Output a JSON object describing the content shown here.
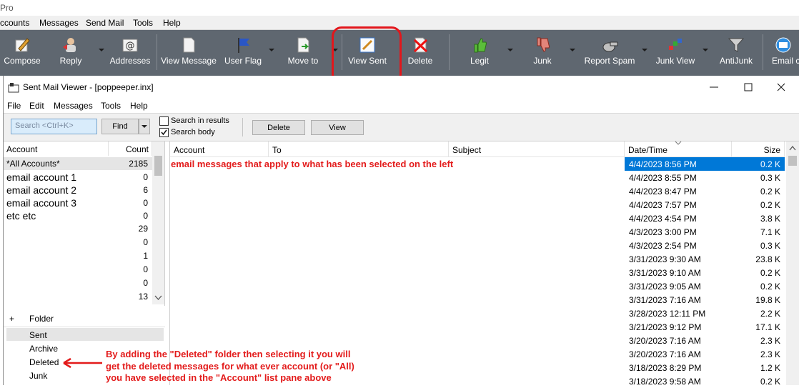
{
  "app": {
    "title_fragment": "Pro",
    "menu": [
      "ccounts",
      "Messages",
      "Send Mail",
      "Tools",
      "Help"
    ]
  },
  "toolbar": {
    "buttons": [
      {
        "label": "Compose",
        "icon": "compose-icon"
      },
      {
        "label": "Reply",
        "icon": "reply-icon"
      },
      {
        "label": "Addresses",
        "icon": "addresses-icon"
      },
      {
        "label": "View Message",
        "icon": "view-message-icon"
      },
      {
        "label": "User Flag",
        "icon": "flag-icon"
      },
      {
        "label": "Move to",
        "icon": "move-to-icon"
      },
      {
        "label": "View Sent",
        "icon": "view-sent-icon"
      },
      {
        "label": "Delete",
        "icon": "delete-icon"
      },
      {
        "label": "Legit",
        "icon": "thumbs-up-icon"
      },
      {
        "label": "Junk",
        "icon": "thumbs-down-icon"
      },
      {
        "label": "Report Spam",
        "icon": "whistle-icon"
      },
      {
        "label": "Junk View",
        "icon": "junk-view-icon"
      },
      {
        "label": "AntiJunk",
        "icon": "filter-icon"
      },
      {
        "label": "Email c",
        "icon": "email-check-icon"
      }
    ]
  },
  "window": {
    "title": "Sent Mail Viewer - [poppeeper.inx]",
    "menu": [
      "File",
      "Edit",
      "Messages",
      "Tools",
      "Help"
    ],
    "search_placeholder": "Search <Ctrl+K>",
    "find_label": "Find",
    "search_in_results": "Search in results",
    "search_body": "Search body",
    "search_in_results_checked": false,
    "search_body_checked": true,
    "delete_label": "Delete",
    "view_label": "View"
  },
  "accounts": {
    "col_account": "Account",
    "col_count": "Count",
    "rows": [
      {
        "name": "*All Accounts*",
        "count": "2185"
      },
      {
        "name": "email account 1",
        "count": "0"
      },
      {
        "name": "email account 2",
        "count": "6"
      },
      {
        "name": "email account 3",
        "count": "0"
      },
      {
        "name": "etc etc",
        "count": "0"
      },
      {
        "name": "",
        "count": "29"
      },
      {
        "name": "",
        "count": "0"
      },
      {
        "name": "",
        "count": "1"
      },
      {
        "name": "",
        "count": "0"
      },
      {
        "name": "",
        "count": "0"
      },
      {
        "name": "",
        "count": "13"
      }
    ]
  },
  "folders": {
    "expander": "+",
    "col_folder": "Folder",
    "items": [
      "Sent",
      "Archive",
      "Deleted",
      "Junk"
    ]
  },
  "messages": {
    "col_account": "Account",
    "col_to": "To",
    "col_subject": "Subject",
    "col_datetime": "Date/Time",
    "col_size": "Size",
    "rows": [
      {
        "date": "4/4/2023 8:56 PM",
        "size": "0.2 K"
      },
      {
        "date": "4/4/2023 8:55 PM",
        "size": "0.3 K"
      },
      {
        "date": "4/4/2023 8:47 PM",
        "size": "0.2 K"
      },
      {
        "date": "4/4/2023 7:57 PM",
        "size": "0.2 K"
      },
      {
        "date": "4/4/2023 4:54 PM",
        "size": "3.8 K"
      },
      {
        "date": "4/3/2023 3:00 PM",
        "size": "7.1 K"
      },
      {
        "date": "4/3/2023 2:54 PM",
        "size": "0.3 K"
      },
      {
        "date": "3/31/2023 9:30 AM",
        "size": "23.8 K"
      },
      {
        "date": "3/31/2023 9:10 AM",
        "size": "0.2 K"
      },
      {
        "date": "3/31/2023 9:05 AM",
        "size": "0.2 K"
      },
      {
        "date": "3/31/2023 7:16 AM",
        "size": "19.8 K"
      },
      {
        "date": "3/28/2023 12:11 PM",
        "size": "2.2 K"
      },
      {
        "date": "3/21/2023 9:12 PM",
        "size": "17.1 K"
      },
      {
        "date": "3/20/2023 7:16 AM",
        "size": "2.3 K"
      },
      {
        "date": "3/20/2023 7:16 AM",
        "size": "2.3 K"
      },
      {
        "date": "3/18/2023 8:29 PM",
        "size": "1.2 K"
      },
      {
        "date": "3/18/2023 9:58 AM",
        "size": "0.2 K"
      }
    ]
  },
  "annotations": {
    "messages_note": "email messages that apply to what has been selected on the left",
    "deleted_note_1": "By adding the \"Deleted\" folder then selecting it you will",
    "deleted_note_2": "get the deleted messages for what ever account (or \"All)",
    "deleted_note_3": "you have selected in the \"Account\" list pane above"
  },
  "colors": {
    "toolbar_bg": "#5f6770",
    "selection": "#0078d7",
    "annotation_red": "#e31b1b"
  }
}
